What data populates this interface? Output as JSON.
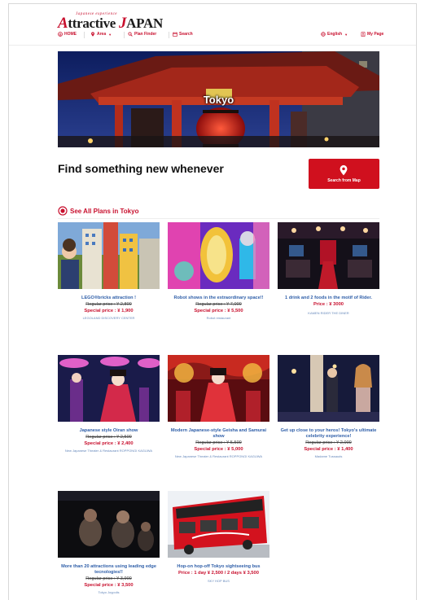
{
  "header": {
    "logo_tagline": "Japanese experience",
    "logo_a": "A",
    "logo_rest": "ttractive ",
    "logo_j": "J",
    "logo_apan": "APAN"
  },
  "nav": {
    "home": "HOME",
    "area": "Area",
    "plan_finder": "Plan Finder",
    "search": "Search",
    "language": "English",
    "my_page": "My Page"
  },
  "hero": {
    "title": "Tokyo"
  },
  "headline": "Find something new whenever",
  "map_button": {
    "label": "Search from Map"
  },
  "section": {
    "title": "See All Plans in Tokyo"
  },
  "plans": [
    {
      "title": "LEGO®bricks attraction !",
      "regular": "Regular price : ¥ 2,800",
      "special": "Special price : ¥ 1,900",
      "venue": "LEGOLAND DISCOVERY CENTER"
    },
    {
      "title": "Robot shows in the extraordinary space!!",
      "regular": "Regular price : ¥ 7,000",
      "special": "Special price : ¥ 5,500",
      "venue": "Robot restaurant"
    },
    {
      "title": "1 drink and 2 foods in the motif of Rider.",
      "regular": "",
      "special": "Price : ¥ 3000",
      "venue": "KAMEN RIDER THE DINER"
    },
    {
      "title": "Japanese style Oiran show",
      "regular": "Regular price : ¥ 2,500",
      "special": "Special price : ¥ 2,400",
      "venue": "New Japanese Theater & Restaurant ROPPONGI KAGUWA"
    },
    {
      "title": "Modern Japanese-style Geisha and Samurai show",
      "regular": "Regular price : ¥ 5,500",
      "special": "Special price : ¥ 5,000",
      "venue": "New Japanese Theater & Restaurant ROPPONGI KAGUWA"
    },
    {
      "title": "Get up close to your heros! Tokyo's ultimate celebrity experience!",
      "regular": "Regular price : ¥ 2,000",
      "special": "Special price : ¥ 1,400",
      "venue": "Madame Tussauds"
    },
    {
      "title": "More than 20 attractions using leading edge tecnologies!!",
      "regular": "Regular price : ¥ 3,900",
      "special": "Special price : ¥ 3,500",
      "venue": "Tokyo Joypolis"
    },
    {
      "title": "Hop-on hop-off Tokyo sightseeing bus",
      "regular": "",
      "special": "Price : 1 day ¥ 2,500 / 2 days ¥ 3,500",
      "venue": "SKY HOP BUS"
    }
  ],
  "colors": {
    "brand_red": "#c8102e",
    "button_red": "#d0101e",
    "link_blue": "#2e5ea8"
  },
  "icons": {
    "home": "home-icon",
    "area": "map-pin-icon",
    "plan_finder": "search-icon",
    "search": "calendar-icon",
    "language": "globe-icon",
    "my_page": "user-book-icon",
    "map_button": "map-pin-icon",
    "section": "target-icon"
  }
}
